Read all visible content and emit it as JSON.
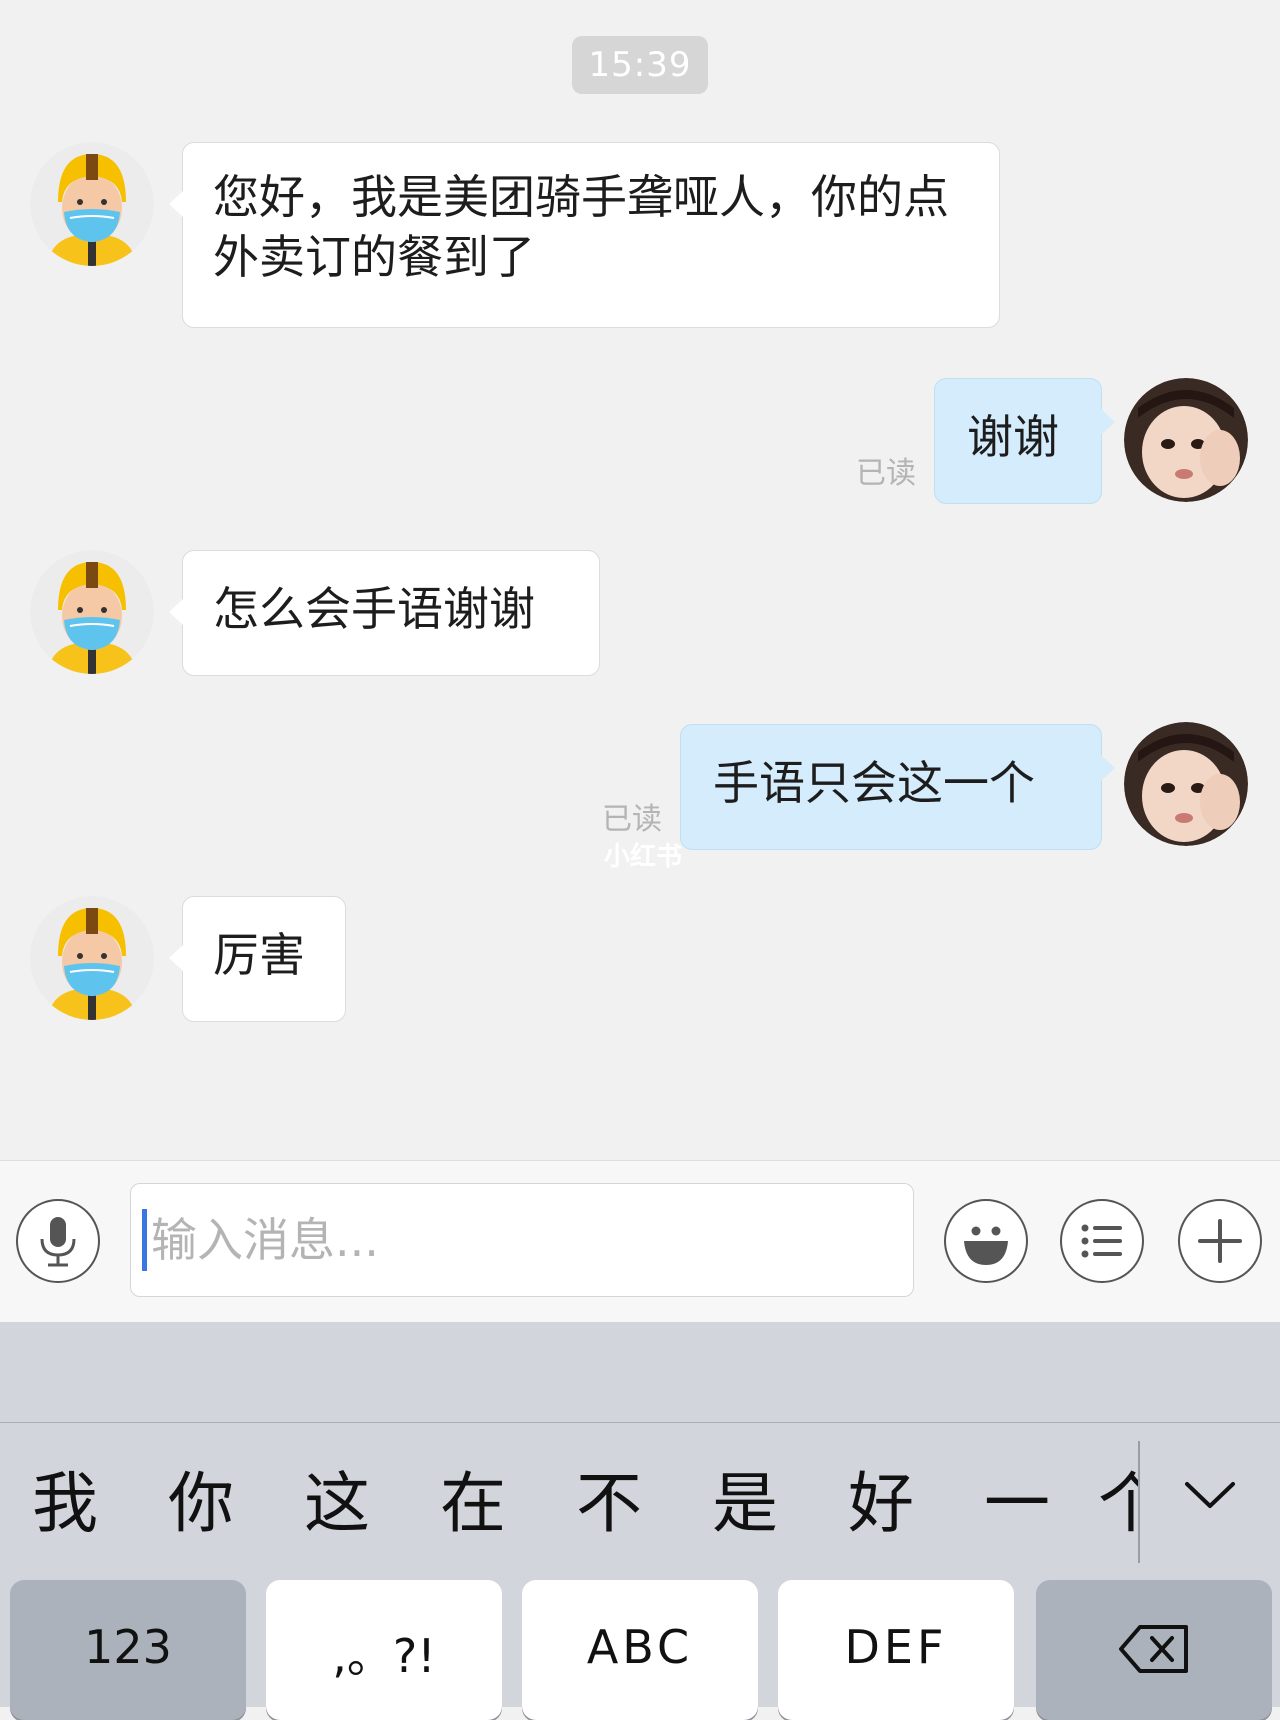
{
  "chat": {
    "timestamp": "15:39",
    "messages": [
      {
        "side": "left",
        "text": "您好，我是美团骑手聋哑人，你的点外卖订的餐到了"
      },
      {
        "side": "right",
        "text": "谢谢",
        "status": "已读"
      },
      {
        "side": "left",
        "text": "怎么会手语谢谢"
      },
      {
        "side": "right",
        "text": "手语只会这一个",
        "status": "已读"
      },
      {
        "side": "left",
        "text": "厉害"
      }
    ],
    "watermark": "小红书"
  },
  "input_bar": {
    "placeholder": "输入消息...",
    "icons": [
      "microphone-icon",
      "emoji-icon",
      "list-icon",
      "plus-icon"
    ]
  },
  "keyboard": {
    "candidates": [
      "我",
      "你",
      "这",
      "在",
      "不",
      "是",
      "好",
      "一",
      "个"
    ],
    "keys": [
      "123",
      ",。?!",
      "ABC",
      "DEF"
    ],
    "icons": [
      "chevron-down-icon",
      "backspace-icon"
    ]
  },
  "colors": {
    "chat_background": "#f1f1f1",
    "incoming_bubble": "#ffffff",
    "outgoing_bubble": "#d4ecfb",
    "caret": "#3a78e0",
    "keyboard_background": "#d2d5db"
  }
}
